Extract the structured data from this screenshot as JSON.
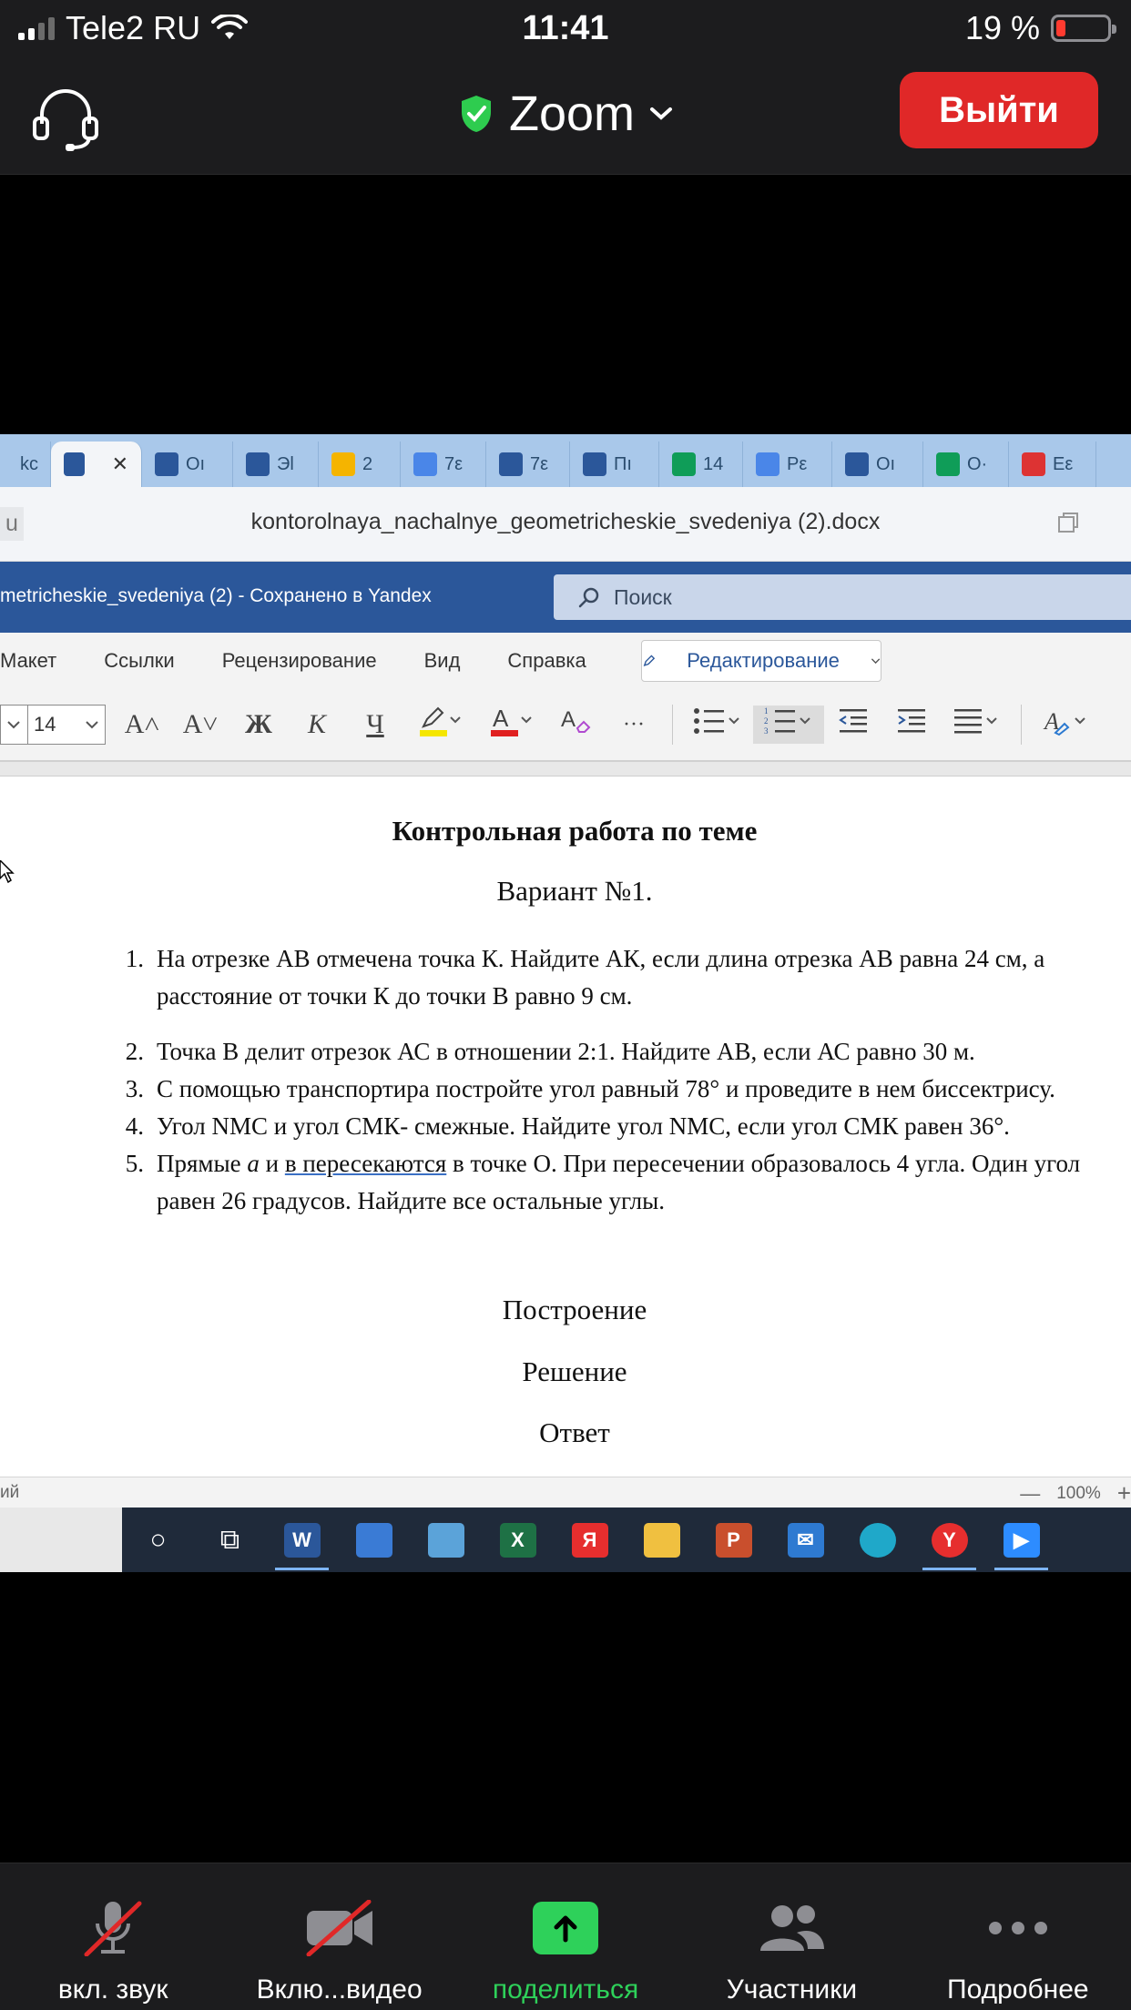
{
  "status_bar": {
    "carrier": "Tele2 RU",
    "time": "11:41",
    "battery_text": "19 %",
    "battery_level": 0.19
  },
  "zoom_header": {
    "title": "Zoom",
    "leave_label": "Выйти",
    "colors": {
      "leave": "#e02828",
      "shield": "#2ecc4f"
    }
  },
  "browser": {
    "tabs": [
      {
        "label": "kc",
        "icon": "word-doc-icon",
        "color": "#2b579a"
      },
      {
        "label": "",
        "icon": "word-doc-icon",
        "color": "#2b579a",
        "active": true
      },
      {
        "label": "Oı",
        "icon": "word-doc-icon",
        "color": "#2b579a"
      },
      {
        "label": "Эl",
        "icon": "edge-refresh-icon",
        "color": "#2b579a"
      },
      {
        "label": "2",
        "icon": "mail-icon",
        "color": "#f5b400"
      },
      {
        "label": "7ε",
        "icon": "document-icon",
        "color": "#4a86e8"
      },
      {
        "label": "7ε",
        "icon": "word-doc-icon",
        "color": "#2b579a"
      },
      {
        "label": "Пı",
        "icon": "word-doc-icon",
        "color": "#2b579a"
      },
      {
        "label": "14",
        "icon": "sheets-plus-icon",
        "color": "#0f9d58"
      },
      {
        "label": "Pε",
        "icon": "document-icon",
        "color": "#4a86e8"
      },
      {
        "label": "Oı",
        "icon": "word-doc-icon",
        "color": "#2b579a"
      },
      {
        "label": "O·",
        "icon": "sheets-plus-icon",
        "color": "#0f9d58"
      },
      {
        "label": "Eε",
        "icon": "flag-icon",
        "color": "#d33"
      }
    ],
    "address_left": "u",
    "address": "kontorolnaya_nachalnye_geometricheskie_svedeniya (2).docx"
  },
  "word": {
    "doc_title": "metricheskie_svedeniya (2)  -  Сохранено в Yandex",
    "search_placeholder": "Поиск",
    "ribbon_tabs": [
      "Макет",
      "Ссылки",
      "Рецензирование",
      "Вид",
      "Справка"
    ],
    "edit_mode": "Редактирование",
    "font_size": "14",
    "tools": {
      "grow": "A˄",
      "shrink": "A˅",
      "bold": "Ж",
      "italic": "К",
      "underline": "Ч",
      "more": "···"
    },
    "status_left": "ий",
    "zoom_level": "100%",
    "zoom_minus": "—",
    "zoom_plus": "+"
  },
  "document": {
    "heading": "Контрольная работа по теме",
    "variant": "Вариант  №1.",
    "questions": [
      {
        "num": "1.",
        "text": "На отрезке АВ отмечена точка К. Найдите АК, если длина отрезка АВ равна 24 см, а расстояние от точки К до точки В равно 9 см."
      },
      {
        "num": "2.",
        "text": "Точка В делит отрезок АС в отношении 2:1. Найдите АВ, если АС равно 30 м."
      },
      {
        "num": "3.",
        "text": "С помощью транспортира постройте угол равный  78° и проведите в нем биссектрису."
      },
      {
        "num": "4.",
        "text": "Угол NMC и угол СМК- смежные. Найдите угол NMC, если угол СМК равен 36°."
      },
      {
        "num": "5.",
        "text_a": "Прямые ",
        "text_var_a": "а",
        "text_b": " и ",
        "text_underlined": "в пересекаются",
        "text_c": " в точке О. При пересечении образовалось 4 угла. Один угол равен 26 градусов.  Найдите все остальные углы."
      }
    ],
    "sections": [
      "Построение",
      "Решение",
      "Ответ"
    ]
  },
  "taskbar": {
    "apps": [
      {
        "icon": "cortana-circle-icon",
        "text": "○"
      },
      {
        "icon": "task-view-icon",
        "text": "⧉"
      },
      {
        "icon": "word-app-icon",
        "text": "W",
        "active": true
      },
      {
        "icon": "store-icon",
        "text": ""
      },
      {
        "icon": "presentation-app-icon",
        "text": ""
      },
      {
        "icon": "excel-app-icon",
        "text": "X"
      },
      {
        "icon": "yandex-app-icon",
        "text": "Я"
      },
      {
        "icon": "file-explorer-icon",
        "text": ""
      },
      {
        "icon": "powerpoint-app-icon",
        "text": "P"
      },
      {
        "icon": "mail-app-icon",
        "text": "✉"
      },
      {
        "icon": "edge-app-icon",
        "text": ""
      },
      {
        "icon": "yandex-browser-icon",
        "text": "Y",
        "active": true
      },
      {
        "icon": "zoom-app-icon",
        "text": "▶",
        "active": true
      }
    ]
  },
  "bottom_bar": {
    "audio": "вкл. звук",
    "video": "Вклю...видео",
    "share": "поделиться",
    "participants": "Участники",
    "more": "Подробнее",
    "colors": {
      "share": "#2ed15a",
      "mute_slash": "#e02828"
    }
  }
}
